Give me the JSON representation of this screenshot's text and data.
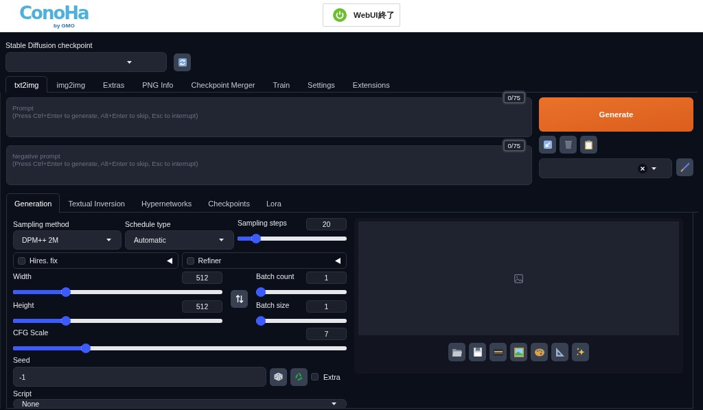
{
  "header": {
    "logo": "ConoHa",
    "logo_sub": "by GMO",
    "stop_button": "WebUI終了"
  },
  "checkpoint": {
    "label": "Stable Diffusion checkpoint"
  },
  "tabs": [
    {
      "label": "txt2img",
      "selected": true
    },
    {
      "label": "img2img",
      "selected": false
    },
    {
      "label": "Extras",
      "selected": false
    },
    {
      "label": "PNG Info",
      "selected": false
    },
    {
      "label": "Checkpoint Merger",
      "selected": false
    },
    {
      "label": "Train",
      "selected": false
    },
    {
      "label": "Settings",
      "selected": false
    },
    {
      "label": "Extensions",
      "selected": false
    }
  ],
  "prompt": {
    "placeholder": "Prompt\n(Press Ctrl+Enter to generate, Alt+Enter to skip, Esc to interrupt)",
    "counter": "0/75"
  },
  "negative_prompt": {
    "placeholder": "Negative prompt\n(Press Ctrl+Enter to generate, Alt+Enter to skip, Esc to interrupt)",
    "counter": "0/75"
  },
  "generate_button": "Generate",
  "subtabs": [
    {
      "label": "Generation",
      "selected": true
    },
    {
      "label": "Textual Inversion",
      "selected": false
    },
    {
      "label": "Hypernetworks",
      "selected": false
    },
    {
      "label": "Checkpoints",
      "selected": false
    },
    {
      "label": "Lora",
      "selected": false
    }
  ],
  "generation": {
    "sampling_method": {
      "label": "Sampling method",
      "value": "DPM++ 2M"
    },
    "schedule_type": {
      "label": "Schedule type",
      "value": "Automatic"
    },
    "sampling_steps": {
      "label": "Sampling steps",
      "value": "20",
      "level": 0.14
    },
    "accordions": [
      {
        "label": "Hires. fix",
        "checked": false,
        "expanded": false
      },
      {
        "label": "Refiner",
        "checked": false,
        "expanded": false
      }
    ],
    "width": {
      "label": "Width",
      "value": "512",
      "level": 0.24
    },
    "height": {
      "label": "Height",
      "value": "512",
      "level": 0.24
    },
    "batch_count": {
      "label": "Batch count",
      "value": "1",
      "level": 0
    },
    "batch_size": {
      "label": "Batch size",
      "value": "1",
      "level": 0
    },
    "cfg_scale": {
      "label": "CFG Scale",
      "value": "7",
      "level": 0.21
    },
    "seed": {
      "label": "Seed",
      "value": "-1"
    },
    "extra": {
      "label": "Extra",
      "checked": false
    },
    "script": {
      "label": "Script",
      "value": "None"
    }
  }
}
